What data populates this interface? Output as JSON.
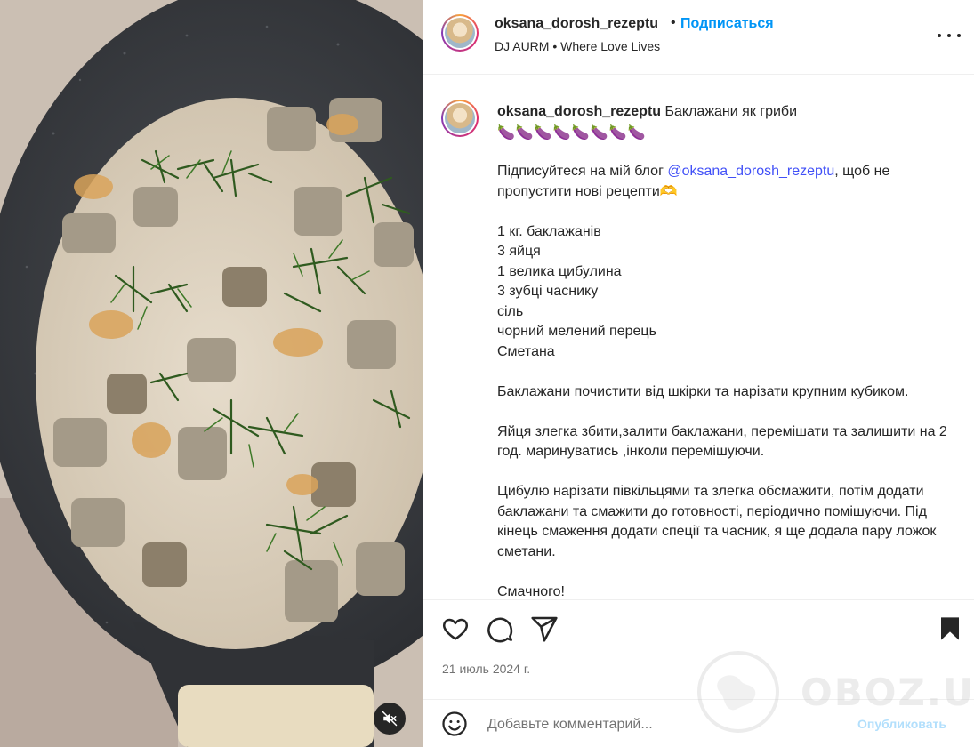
{
  "header": {
    "username": "oksana_dorosh_rezeptu",
    "separator": "•",
    "follow_label": "Подписаться",
    "audio": "DJ AURM • Where Love Lives"
  },
  "caption": {
    "username": "oksana_dorosh_rezeptu",
    "title": "Баклажани як гриби",
    "eggplants": "🍆🍆🍆🍆🍆🍆🍆🍆",
    "intro_before": "Підписуйтеся на мій блог ",
    "mention": "@oksana_dorosh_rezeptu",
    "intro_after": ", щоб не пропустити нові рецепти🫶",
    "ingredients": [
      "1 кг. баклажанів",
      "3 яйця",
      "1 велика цибулина",
      "3 зубці часнику",
      "сіль",
      "чорний мелений перець",
      "Сметана"
    ],
    "step1": "Баклажани почистити від шкірки та нарізати крупним кубиком.",
    "step2": "Яйця злегка збити,залити баклажани, перемішати та залишити на 2 год. маринуватись ,інколи перемішуючи.",
    "step3": "Цибулю нарізати півкільцями та злегка обсмажити, потім додати баклажани та смажити до готовності, періодично помішуючи. Під кінець смаження додати спеції та часник, я ще додала пару ложок сметани.",
    "closing": "Смачного!"
  },
  "actions": {
    "like_icon": "heart-icon",
    "comment_icon": "comment-icon",
    "share_icon": "share-icon",
    "save_icon": "bookmark-icon"
  },
  "date": "21 июль 2024 г.",
  "comment": {
    "placeholder": "Добавьте комментарий...",
    "publish_label": "Опубликовать"
  },
  "watermark": "OBOZ.UA",
  "colors": {
    "link": "#0095f6",
    "mention": "#4150f7",
    "publish_disabled": "#b2dffc",
    "muted": "#737373"
  }
}
